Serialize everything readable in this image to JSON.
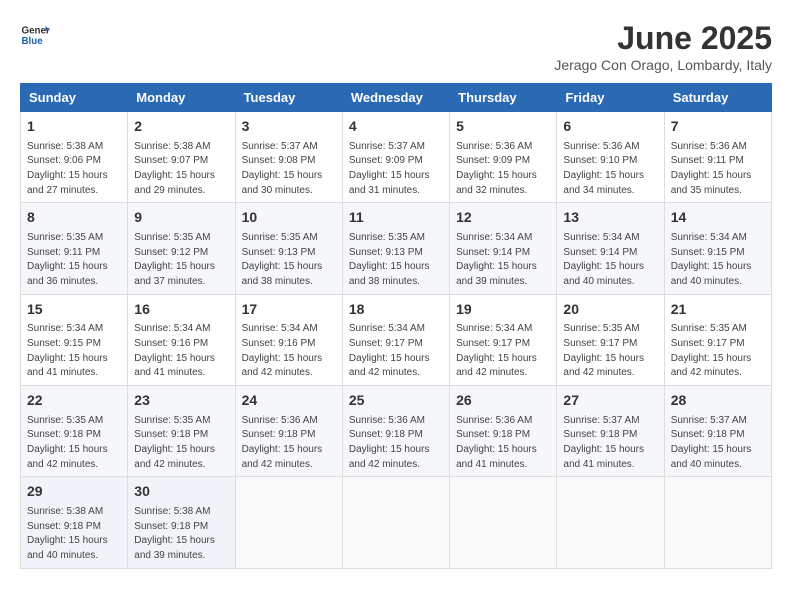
{
  "header": {
    "logo_line1": "General",
    "logo_line2": "Blue",
    "title": "June 2025",
    "subtitle": "Jerago Con Orago, Lombardy, Italy"
  },
  "weekdays": [
    "Sunday",
    "Monday",
    "Tuesday",
    "Wednesday",
    "Thursday",
    "Friday",
    "Saturday"
  ],
  "weeks": [
    [
      {
        "day": "1",
        "sunrise": "Sunrise: 5:38 AM",
        "sunset": "Sunset: 9:06 PM",
        "daylight": "Daylight: 15 hours and 27 minutes."
      },
      {
        "day": "2",
        "sunrise": "Sunrise: 5:38 AM",
        "sunset": "Sunset: 9:07 PM",
        "daylight": "Daylight: 15 hours and 29 minutes."
      },
      {
        "day": "3",
        "sunrise": "Sunrise: 5:37 AM",
        "sunset": "Sunset: 9:08 PM",
        "daylight": "Daylight: 15 hours and 30 minutes."
      },
      {
        "day": "4",
        "sunrise": "Sunrise: 5:37 AM",
        "sunset": "Sunset: 9:09 PM",
        "daylight": "Daylight: 15 hours and 31 minutes."
      },
      {
        "day": "5",
        "sunrise": "Sunrise: 5:36 AM",
        "sunset": "Sunset: 9:09 PM",
        "daylight": "Daylight: 15 hours and 32 minutes."
      },
      {
        "day": "6",
        "sunrise": "Sunrise: 5:36 AM",
        "sunset": "Sunset: 9:10 PM",
        "daylight": "Daylight: 15 hours and 34 minutes."
      },
      {
        "day": "7",
        "sunrise": "Sunrise: 5:36 AM",
        "sunset": "Sunset: 9:11 PM",
        "daylight": "Daylight: 15 hours and 35 minutes."
      }
    ],
    [
      {
        "day": "8",
        "sunrise": "Sunrise: 5:35 AM",
        "sunset": "Sunset: 9:11 PM",
        "daylight": "Daylight: 15 hours and 36 minutes."
      },
      {
        "day": "9",
        "sunrise": "Sunrise: 5:35 AM",
        "sunset": "Sunset: 9:12 PM",
        "daylight": "Daylight: 15 hours and 37 minutes."
      },
      {
        "day": "10",
        "sunrise": "Sunrise: 5:35 AM",
        "sunset": "Sunset: 9:13 PM",
        "daylight": "Daylight: 15 hours and 38 minutes."
      },
      {
        "day": "11",
        "sunrise": "Sunrise: 5:35 AM",
        "sunset": "Sunset: 9:13 PM",
        "daylight": "Daylight: 15 hours and 38 minutes."
      },
      {
        "day": "12",
        "sunrise": "Sunrise: 5:34 AM",
        "sunset": "Sunset: 9:14 PM",
        "daylight": "Daylight: 15 hours and 39 minutes."
      },
      {
        "day": "13",
        "sunrise": "Sunrise: 5:34 AM",
        "sunset": "Sunset: 9:14 PM",
        "daylight": "Daylight: 15 hours and 40 minutes."
      },
      {
        "day": "14",
        "sunrise": "Sunrise: 5:34 AM",
        "sunset": "Sunset: 9:15 PM",
        "daylight": "Daylight: 15 hours and 40 minutes."
      }
    ],
    [
      {
        "day": "15",
        "sunrise": "Sunrise: 5:34 AM",
        "sunset": "Sunset: 9:15 PM",
        "daylight": "Daylight: 15 hours and 41 minutes."
      },
      {
        "day": "16",
        "sunrise": "Sunrise: 5:34 AM",
        "sunset": "Sunset: 9:16 PM",
        "daylight": "Daylight: 15 hours and 41 minutes."
      },
      {
        "day": "17",
        "sunrise": "Sunrise: 5:34 AM",
        "sunset": "Sunset: 9:16 PM",
        "daylight": "Daylight: 15 hours and 42 minutes."
      },
      {
        "day": "18",
        "sunrise": "Sunrise: 5:34 AM",
        "sunset": "Sunset: 9:17 PM",
        "daylight": "Daylight: 15 hours and 42 minutes."
      },
      {
        "day": "19",
        "sunrise": "Sunrise: 5:34 AM",
        "sunset": "Sunset: 9:17 PM",
        "daylight": "Daylight: 15 hours and 42 minutes."
      },
      {
        "day": "20",
        "sunrise": "Sunrise: 5:35 AM",
        "sunset": "Sunset: 9:17 PM",
        "daylight": "Daylight: 15 hours and 42 minutes."
      },
      {
        "day": "21",
        "sunrise": "Sunrise: 5:35 AM",
        "sunset": "Sunset: 9:17 PM",
        "daylight": "Daylight: 15 hours and 42 minutes."
      }
    ],
    [
      {
        "day": "22",
        "sunrise": "Sunrise: 5:35 AM",
        "sunset": "Sunset: 9:18 PM",
        "daylight": "Daylight: 15 hours and 42 minutes."
      },
      {
        "day": "23",
        "sunrise": "Sunrise: 5:35 AM",
        "sunset": "Sunset: 9:18 PM",
        "daylight": "Daylight: 15 hours and 42 minutes."
      },
      {
        "day": "24",
        "sunrise": "Sunrise: 5:36 AM",
        "sunset": "Sunset: 9:18 PM",
        "daylight": "Daylight: 15 hours and 42 minutes."
      },
      {
        "day": "25",
        "sunrise": "Sunrise: 5:36 AM",
        "sunset": "Sunset: 9:18 PM",
        "daylight": "Daylight: 15 hours and 42 minutes."
      },
      {
        "day": "26",
        "sunrise": "Sunrise: 5:36 AM",
        "sunset": "Sunset: 9:18 PM",
        "daylight": "Daylight: 15 hours and 41 minutes."
      },
      {
        "day": "27",
        "sunrise": "Sunrise: 5:37 AM",
        "sunset": "Sunset: 9:18 PM",
        "daylight": "Daylight: 15 hours and 41 minutes."
      },
      {
        "day": "28",
        "sunrise": "Sunrise: 5:37 AM",
        "sunset": "Sunset: 9:18 PM",
        "daylight": "Daylight: 15 hours and 40 minutes."
      }
    ],
    [
      {
        "day": "29",
        "sunrise": "Sunrise: 5:38 AM",
        "sunset": "Sunset: 9:18 PM",
        "daylight": "Daylight: 15 hours and 40 minutes."
      },
      {
        "day": "30",
        "sunrise": "Sunrise: 5:38 AM",
        "sunset": "Sunset: 9:18 PM",
        "daylight": "Daylight: 15 hours and 39 minutes."
      },
      null,
      null,
      null,
      null,
      null
    ]
  ]
}
